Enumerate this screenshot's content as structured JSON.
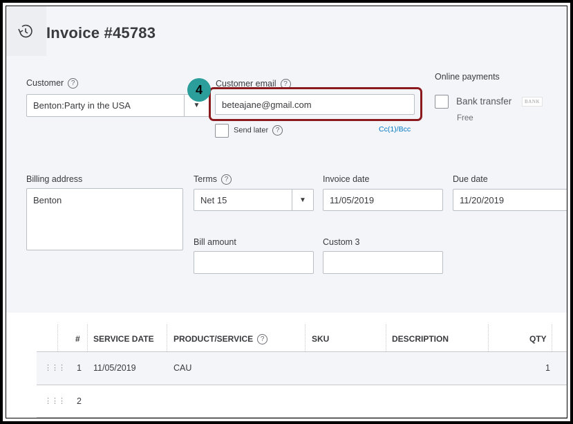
{
  "header": {
    "title": "Invoice #45783",
    "history_icon": "history-clock-icon"
  },
  "customer": {
    "label": "Customer",
    "value": "Benton:Party in the USA"
  },
  "customer_email": {
    "label": "Customer email",
    "value": "beteajane@gmail.com",
    "cc_bcc": "Cc(1)/Bcc",
    "send_later": "Send later"
  },
  "step_badge": "4",
  "online_payments": {
    "label": "Online payments",
    "bank_transfer": "Bank transfer",
    "bank_logo": "BANK",
    "free": "Free"
  },
  "billing_address": {
    "label": "Billing address",
    "value": "Benton"
  },
  "terms": {
    "label": "Terms",
    "value": "Net 15"
  },
  "invoice_date": {
    "label": "Invoice date",
    "value": "11/05/2019"
  },
  "due_date": {
    "label": "Due date",
    "value": "11/20/2019"
  },
  "bill_amount": {
    "label": "Bill amount",
    "value": ""
  },
  "custom3": {
    "label": "Custom 3",
    "value": ""
  },
  "help_glyph": "?",
  "table": {
    "headers": {
      "num": "#",
      "service_date": "SERVICE DATE",
      "product": "PRODUCT/SERVICE",
      "sku": "SKU",
      "description": "DESCRIPTION",
      "qty": "QTY"
    },
    "rows": [
      {
        "num": "1",
        "service_date": "11/05/2019",
        "product": "CAU",
        "sku": "",
        "description": "",
        "qty": "1"
      },
      {
        "num": "2",
        "service_date": "",
        "product": "",
        "sku": "",
        "description": "",
        "qty": ""
      }
    ]
  },
  "colors": {
    "accent_red": "#8b1a1f",
    "badge_teal": "#2b9d9a",
    "link_blue": "#0077c5",
    "background": "#f4f5f8"
  }
}
